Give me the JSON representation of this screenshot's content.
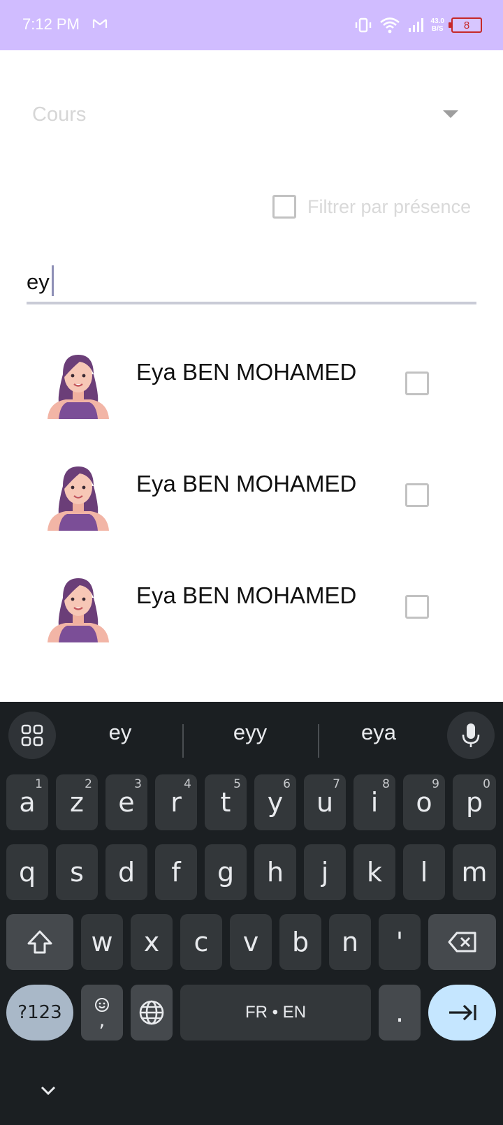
{
  "status_bar": {
    "time": "7:12 PM",
    "net_speed_value": "43.0",
    "net_speed_unit": "B/S",
    "battery_level": "8",
    "bg_color": "#d0bcff"
  },
  "form": {
    "course_dropdown_placeholder": "Cours",
    "filter_label": "Filtrer par présence",
    "filter_checked": false,
    "search_value": "ey"
  },
  "students": [
    {
      "name": "Eya BEN MOHAMED",
      "checked": false
    },
    {
      "name": "Eya BEN MOHAMED",
      "checked": false
    },
    {
      "name": "Eya BEN MOHAMED",
      "checked": false
    }
  ],
  "keyboard": {
    "suggestions": [
      "ey",
      "eyy",
      "eya"
    ],
    "row1": [
      {
        "key": "a",
        "hint": "1"
      },
      {
        "key": "z",
        "hint": "2"
      },
      {
        "key": "e",
        "hint": "3"
      },
      {
        "key": "r",
        "hint": "4"
      },
      {
        "key": "t",
        "hint": "5"
      },
      {
        "key": "y",
        "hint": "6"
      },
      {
        "key": "u",
        "hint": "7"
      },
      {
        "key": "i",
        "hint": "8"
      },
      {
        "key": "o",
        "hint": "9"
      },
      {
        "key": "p",
        "hint": "0"
      }
    ],
    "row2": [
      "q",
      "s",
      "d",
      "f",
      "g",
      "h",
      "j",
      "k",
      "l",
      "m"
    ],
    "row3": [
      "w",
      "x",
      "c",
      "v",
      "b",
      "n",
      "'"
    ],
    "symbols_label": "?123",
    "comma_label": ",",
    "space_label": "FR • EN",
    "period_label": "."
  }
}
